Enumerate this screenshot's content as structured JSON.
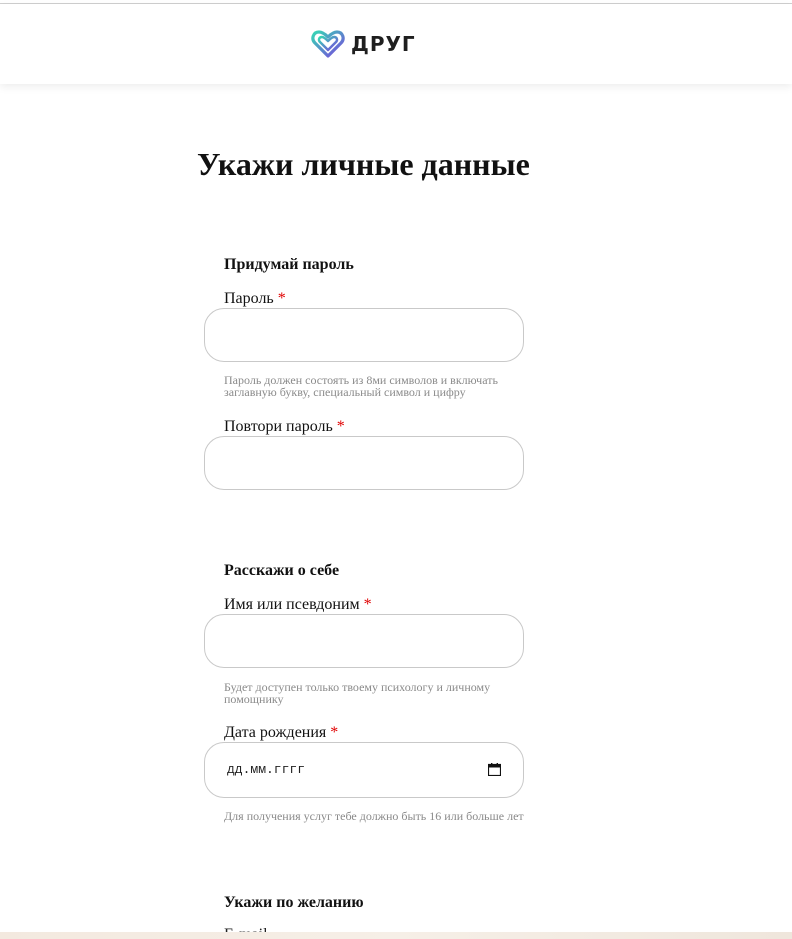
{
  "header": {
    "brand_name": "ДРУГ",
    "logo_icon": "heart-logo-icon",
    "logo_colors": [
      "#3ad6b6",
      "#7b4de0"
    ]
  },
  "page": {
    "title": "Укажи личные данные"
  },
  "password_section": {
    "title": "Придумай пароль",
    "password_label": "Пароль",
    "password_value": "",
    "password_hint": "Пароль должен состоять из 8ми символов и включать заглавную букву, специальный символ и цифру",
    "repeat_label": "Повтори пароль",
    "repeat_value": ""
  },
  "about_section": {
    "title": "Расскажи о себе",
    "name_label": "Имя или псевдоним",
    "name_value": "",
    "name_hint": "Будет доступен только твоему психологу и личному помощнику",
    "birth_label": "Дата рождения",
    "birth_placeholder": "дд.мм.гггг",
    "birth_hint": "Для получения услуг тебе должно быть 16 или больше лет",
    "calendar_icon": "calendar-icon"
  },
  "optional_section": {
    "title": "Укажи по желанию",
    "next_label_partial": "E-mail"
  },
  "required_marker": "*",
  "colors": {
    "required": "#e00000",
    "hint_text": "#8a8a8a",
    "input_border": "#c9c9c9"
  }
}
